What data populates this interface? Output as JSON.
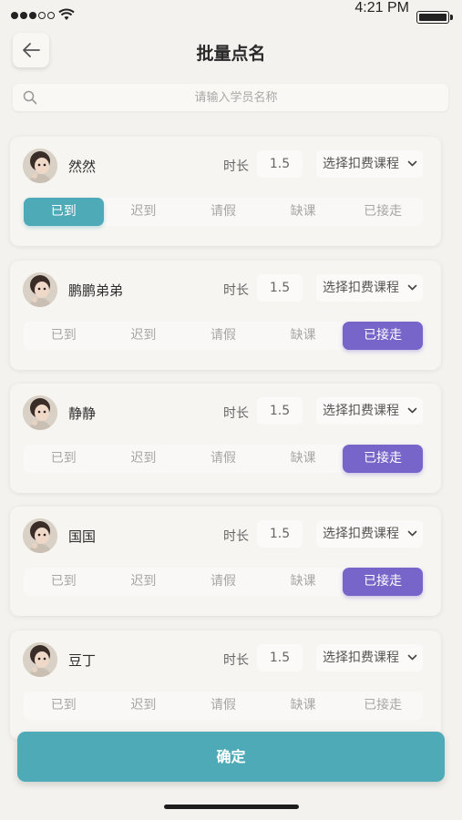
{
  "status_bar": {
    "time": "4:21 PM"
  },
  "nav": {
    "title": "批量点名"
  },
  "search": {
    "placeholder": "请输入学员名称"
  },
  "labels": {
    "duration": "时长"
  },
  "status_options": [
    "已到",
    "迟到",
    "请假",
    "缺课",
    "已接走"
  ],
  "students": [
    {
      "name": "然然",
      "duration": "1.5",
      "course": "选择扣费课程",
      "selected": "已到"
    },
    {
      "name": "鹏鹏弟弟",
      "duration": "1.5",
      "course": "选择扣费课程",
      "selected": "已接走"
    },
    {
      "name": "静静",
      "duration": "1.5",
      "course": "选择扣费课程",
      "selected": "已接走"
    },
    {
      "name": "国国",
      "duration": "1.5",
      "course": "选择扣费课程",
      "selected": "已接走"
    },
    {
      "name": "豆丁",
      "duration": "1.5",
      "course": "选择扣费课程",
      "selected": ""
    }
  ],
  "confirm_label": "确定",
  "colors": {
    "accent_teal": "#4faab8",
    "accent_purple": "#7765c9"
  },
  "icons": [
    "signal-icon",
    "wifi-icon",
    "battery-icon",
    "back-arrow-icon",
    "search-icon",
    "chevron-down-icon"
  ]
}
